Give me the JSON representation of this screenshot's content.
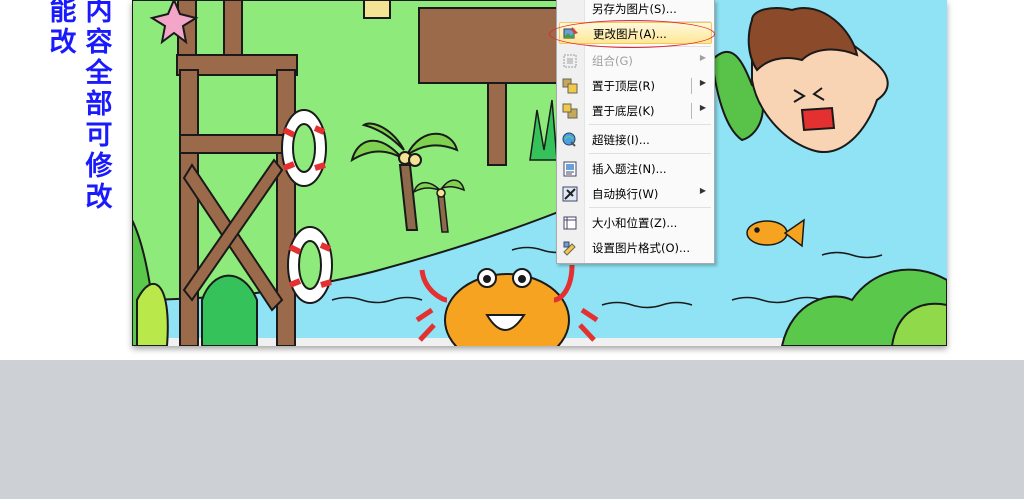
{
  "side_caption": {
    "col1": "能改",
    "col2": "内容全部可修改"
  },
  "context_menu": {
    "items": [
      {
        "label": "另存为图片(S)...",
        "icon": "save-picture-icon",
        "enabled": true
      },
      {
        "label": "更改图片(A)...",
        "icon": "change-picture-icon",
        "enabled": true,
        "highlighted": true
      },
      {
        "label": "组合(G)",
        "icon": "group-icon",
        "enabled": false,
        "submenu": true
      },
      {
        "label": "置于顶层(R)",
        "icon": "bring-to-front-icon",
        "enabled": true,
        "submenu": true
      },
      {
        "label": "置于底层(K)",
        "icon": "send-to-back-icon",
        "enabled": true,
        "submenu": true
      },
      {
        "label": "超链接(I)...",
        "icon": "hyperlink-icon",
        "enabled": true
      },
      {
        "label": "插入题注(N)...",
        "icon": "insert-caption-icon",
        "enabled": true
      },
      {
        "label": "自动换行(W)",
        "icon": "text-wrap-icon",
        "enabled": true,
        "submenu": true
      },
      {
        "label": "大小和位置(Z)...",
        "icon": "size-position-icon",
        "enabled": true
      },
      {
        "label": "设置图片格式(O)...",
        "icon": "format-picture-icon",
        "enabled": true
      }
    ]
  },
  "colors": {
    "caption_blue": "#1a1aff",
    "sky_blue": "#8fe3f5",
    "grass_green": "#8eea7a",
    "highlight_red": "#e8262b"
  }
}
